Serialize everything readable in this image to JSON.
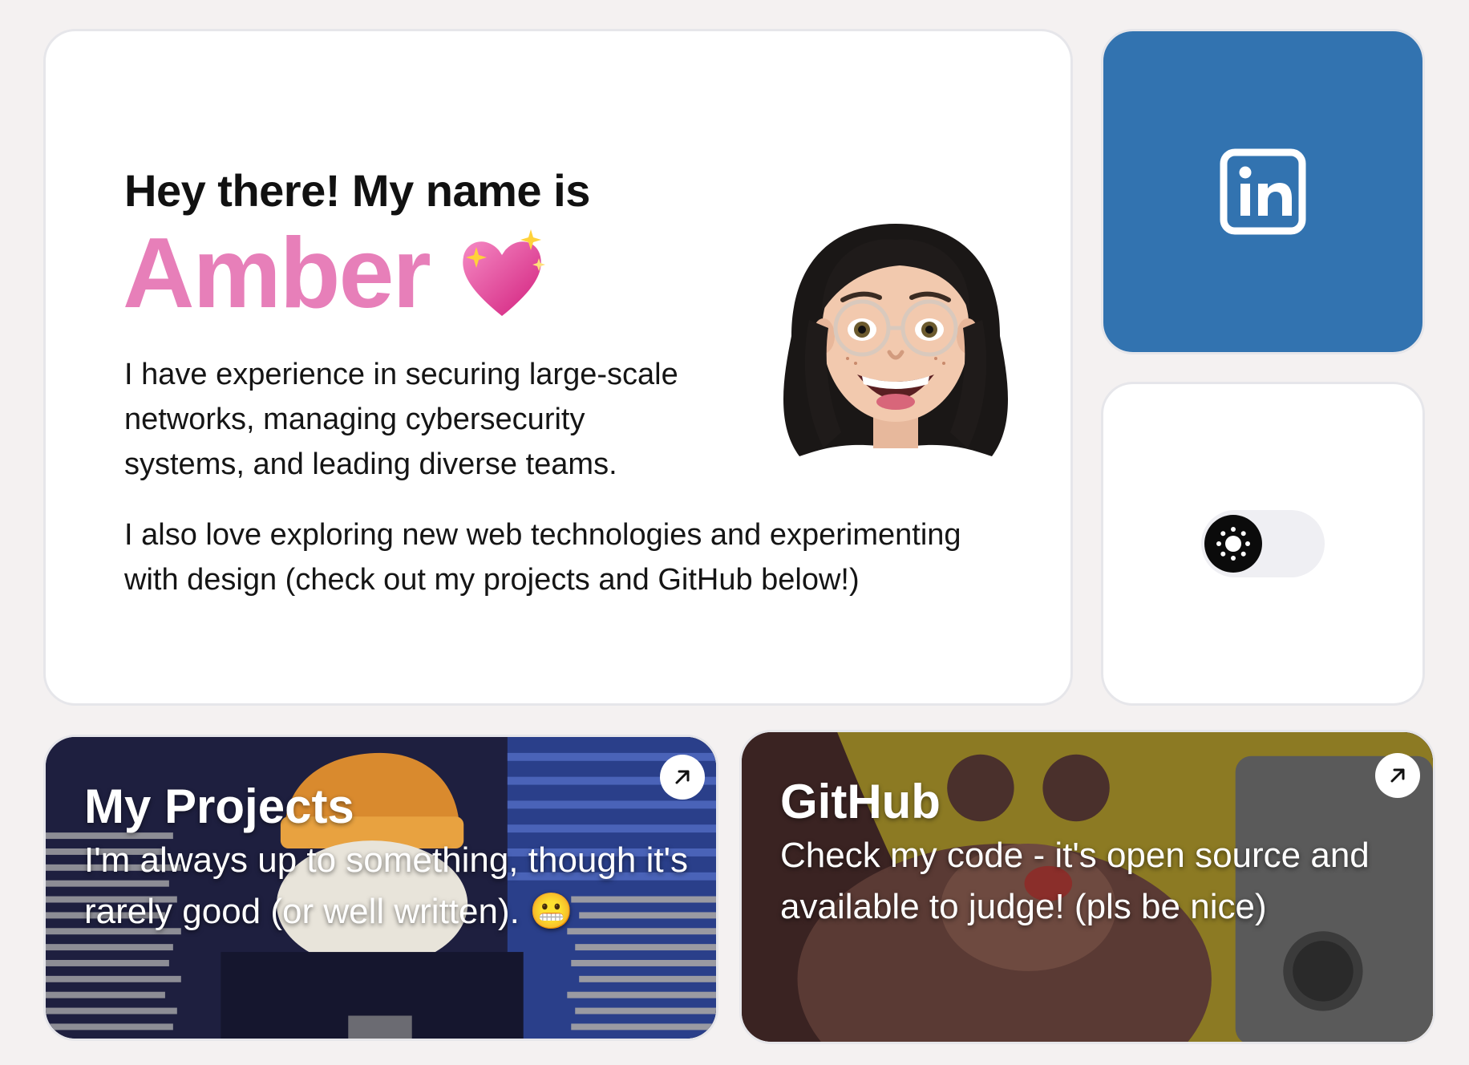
{
  "intro": {
    "greeting": "Hey there! My name is",
    "name": "Amber",
    "heart_emoji": "sparkling-heart",
    "bio_1": "I have experience in securing large-scale networks, managing cybersecurity systems, and leading diverse teams.",
    "bio_2": "I also love exploring new web technologies and experimenting with design (check out my projects and GitHub below!)",
    "avatar": "memoji-avatar"
  },
  "linkedin": {
    "icon": "linkedin-icon",
    "color": "#3273b0"
  },
  "theme_toggle": {
    "icon": "sun-icon",
    "state": "light"
  },
  "projects": {
    "title": "My Projects",
    "description": "I'm always up to something, though it's rarely good (or well written). 😬",
    "icon": "arrow-up-right-icon"
  },
  "github": {
    "title": "GitHub",
    "description": "Check my code - it's open source and available to judge! (pls be nice)",
    "icon": "arrow-up-right-icon",
    "logo": "github-logo-icon"
  },
  "colors": {
    "background": "#f4f1f1",
    "accent_pink": "#e77fb9",
    "linkedin_blue": "#3273b0"
  }
}
